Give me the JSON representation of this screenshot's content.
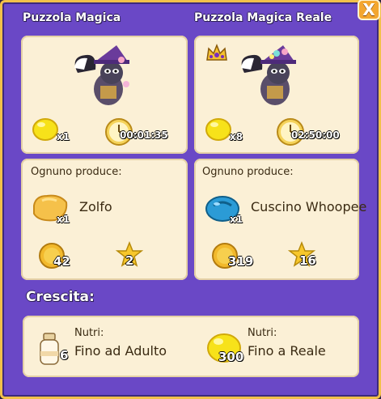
{
  "window": {
    "close_label": "X"
  },
  "left": {
    "title": "Puzzola Magica",
    "lemon_count": "x1",
    "timer": "00:01:35",
    "produces_label": "Ognuno produce:",
    "product_name": "Zolfo",
    "product_count": "x1",
    "coin_value": "42",
    "star_value": "2"
  },
  "right": {
    "title": "Puzzola Magica Reale",
    "lemon_count": "x8",
    "timer": "02:50:00",
    "produces_label": "Ognuno produce:",
    "product_name": "Cuscino Whoopee",
    "product_count": "x1",
    "coin_value": "319",
    "star_value": "16"
  },
  "growth": {
    "title": "Crescita:",
    "item1_label": "Nutri:",
    "item1_text": "Fino ad Adulto",
    "item1_count": "6",
    "item2_label": "Nutri:",
    "item2_text": "Fino a Reale",
    "item2_count": "300"
  },
  "colors": {
    "background": "#6a48c6",
    "border": "#f2c14a",
    "panel": "#fbf0d6"
  }
}
